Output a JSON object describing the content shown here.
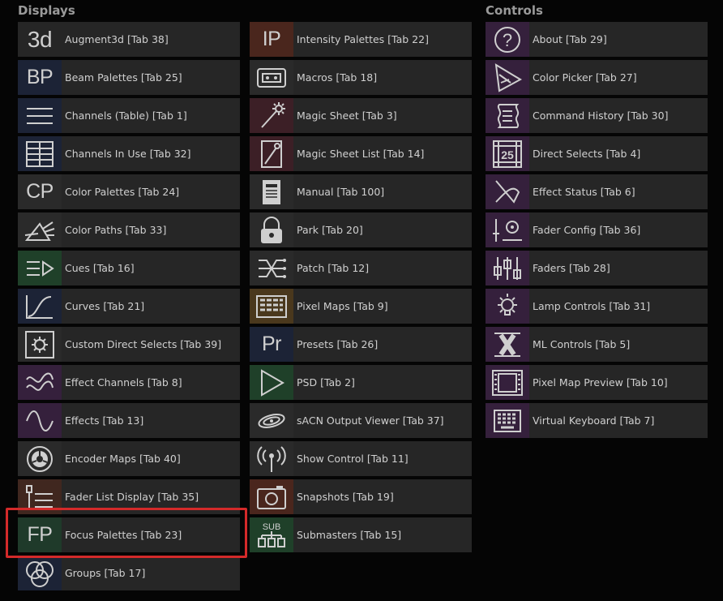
{
  "displays": {
    "title": "Displays",
    "col1": [
      {
        "label": "Augment3d [Tab 38]",
        "icon": "augment3d-icon",
        "icon_text": "3d",
        "color": "#262626"
      },
      {
        "label": "Beam Palettes [Tab 25]",
        "icon": "beam-palette-icon",
        "icon_text": "BP",
        "color": "#1c2336"
      },
      {
        "label": "Channels (Table) [Tab 1]",
        "icon": "table-lines-icon",
        "icon_text": "",
        "color": "#1c2336"
      },
      {
        "label": "Channels In Use [Tab 32]",
        "icon": "channels-in-use-icon",
        "icon_text": "",
        "color": "#1c2336"
      },
      {
        "label": "Color Palettes [Tab 24]",
        "icon": "color-palette-icon",
        "icon_text": "CP",
        "color": "#2a2a2a"
      },
      {
        "label": "Color Paths [Tab 33]",
        "icon": "prism-icon",
        "icon_text": "",
        "color": "#2a2a2a"
      },
      {
        "label": "Cues [Tab 16]",
        "icon": "cue-list-icon",
        "icon_text": "",
        "color": "#1f4029"
      },
      {
        "label": "Curves [Tab 21]",
        "icon": "curve-icon",
        "icon_text": "",
        "color": "#1c2336"
      },
      {
        "label": "Custom Direct Selects [Tab 39]",
        "icon": "gear-box-icon",
        "icon_text": "",
        "color": "#2a2a2a"
      },
      {
        "label": "Effect Channels [Tab 8]",
        "icon": "effect-channels-icon",
        "icon_text": "",
        "color": "#35203c"
      },
      {
        "label": "Effects [Tab 13]",
        "icon": "sine-wave-icon",
        "icon_text": "",
        "color": "#35203c"
      },
      {
        "label": "Encoder Maps [Tab 40]",
        "icon": "encoder-icon",
        "icon_text": "",
        "color": "#2a2a2a"
      },
      {
        "label": "Fader List Display [Tab 35]",
        "icon": "fader-list-icon",
        "icon_text": "",
        "color": "#40271f"
      },
      {
        "label": "Focus Palettes [Tab 23]",
        "icon": "focus-palette-icon",
        "icon_text": "FP",
        "color": "#1f3a2a"
      },
      {
        "label": "Groups [Tab 17]",
        "icon": "groups-icon",
        "icon_text": "",
        "color": "#1c2336"
      }
    ],
    "col2": [
      {
        "label": "Intensity Palettes [Tab 22]",
        "icon": "intensity-palette-icon",
        "icon_text": "IP",
        "color": "#4a261d"
      },
      {
        "label": "Macros [Tab 18]",
        "icon": "macro-tape-icon",
        "icon_text": "",
        "color": "#2a2a2a"
      },
      {
        "label": "Magic Sheet [Tab 3]",
        "icon": "magic-wand-icon",
        "icon_text": "",
        "color": "#3c1f26"
      },
      {
        "label": "Magic Sheet List [Tab 14]",
        "icon": "magic-sheet-list-icon",
        "icon_text": "",
        "color": "#3c1f26"
      },
      {
        "label": "Manual [Tab 100]",
        "icon": "manual-book-icon",
        "icon_text": "",
        "color": "#2a2a2a"
      },
      {
        "label": "Park [Tab 20]",
        "icon": "padlock-icon",
        "icon_text": "",
        "color": "#2a2a2a"
      },
      {
        "label": "Patch [Tab 12]",
        "icon": "patch-icon",
        "icon_text": "",
        "color": "#2a2a2a"
      },
      {
        "label": "Pixel Maps [Tab 9]",
        "icon": "pixel-map-icon",
        "icon_text": "",
        "color": "#4a381d"
      },
      {
        "label": "Presets [Tab 26]",
        "icon": "preset-icon",
        "icon_text": "Pr",
        "color": "#1c2336"
      },
      {
        "label": "PSD [Tab 2]",
        "icon": "play-icon",
        "icon_text": "",
        "color": "#1f4029"
      },
      {
        "label": "sACN Output Viewer [Tab 37]",
        "icon": "sacn-galaxy-icon",
        "icon_text": "",
        "color": "#2a2a2a"
      },
      {
        "label": "Show Control [Tab 11]",
        "icon": "broadcast-icon",
        "icon_text": "",
        "color": "#2a2a2a"
      },
      {
        "label": "Snapshots [Tab 19]",
        "icon": "camera-icon",
        "icon_text": "",
        "color": "#4a261d"
      },
      {
        "label": "Submasters [Tab 15]",
        "icon": "submaster-icon",
        "icon_text": "SUB",
        "color": "#1f4029"
      }
    ]
  },
  "controls": {
    "title": "Controls",
    "col3": [
      {
        "label": "About [Tab 29]",
        "icon": "question-icon",
        "icon_text": "?",
        "color": "#35203c"
      },
      {
        "label": "Color Picker [Tab 27]",
        "icon": "color-picker-icon",
        "icon_text": "",
        "color": "#35203c"
      },
      {
        "label": "Command History [Tab 30]",
        "icon": "scroll-icon",
        "icon_text": "",
        "color": "#35203c"
      },
      {
        "label": "Direct Selects [Tab 4]",
        "icon": "direct-select-icon",
        "icon_text": "25",
        "color": "#35203c"
      },
      {
        "label": "Effect Status [Tab 6]",
        "icon": "effect-status-icon",
        "icon_text": "",
        "color": "#35203c"
      },
      {
        "label": "Fader Config [Tab 36]",
        "icon": "fader-config-icon",
        "icon_text": "",
        "color": "#35203c"
      },
      {
        "label": "Faders [Tab 28]",
        "icon": "faders-icon",
        "icon_text": "",
        "color": "#35203c"
      },
      {
        "label": "Lamp Controls [Tab 31]",
        "icon": "lamp-icon",
        "icon_text": "",
        "color": "#35203c"
      },
      {
        "label": "ML Controls [Tab 5]",
        "icon": "ml-controls-icon",
        "icon_text": "",
        "color": "#35203c"
      },
      {
        "label": "Pixel Map Preview [Tab 10]",
        "icon": "film-strip-icon",
        "icon_text": "",
        "color": "#35203c"
      },
      {
        "label": "Virtual Keyboard [Tab 7]",
        "icon": "keyboard-icon",
        "icon_text": "",
        "color": "#35203c"
      }
    ]
  }
}
